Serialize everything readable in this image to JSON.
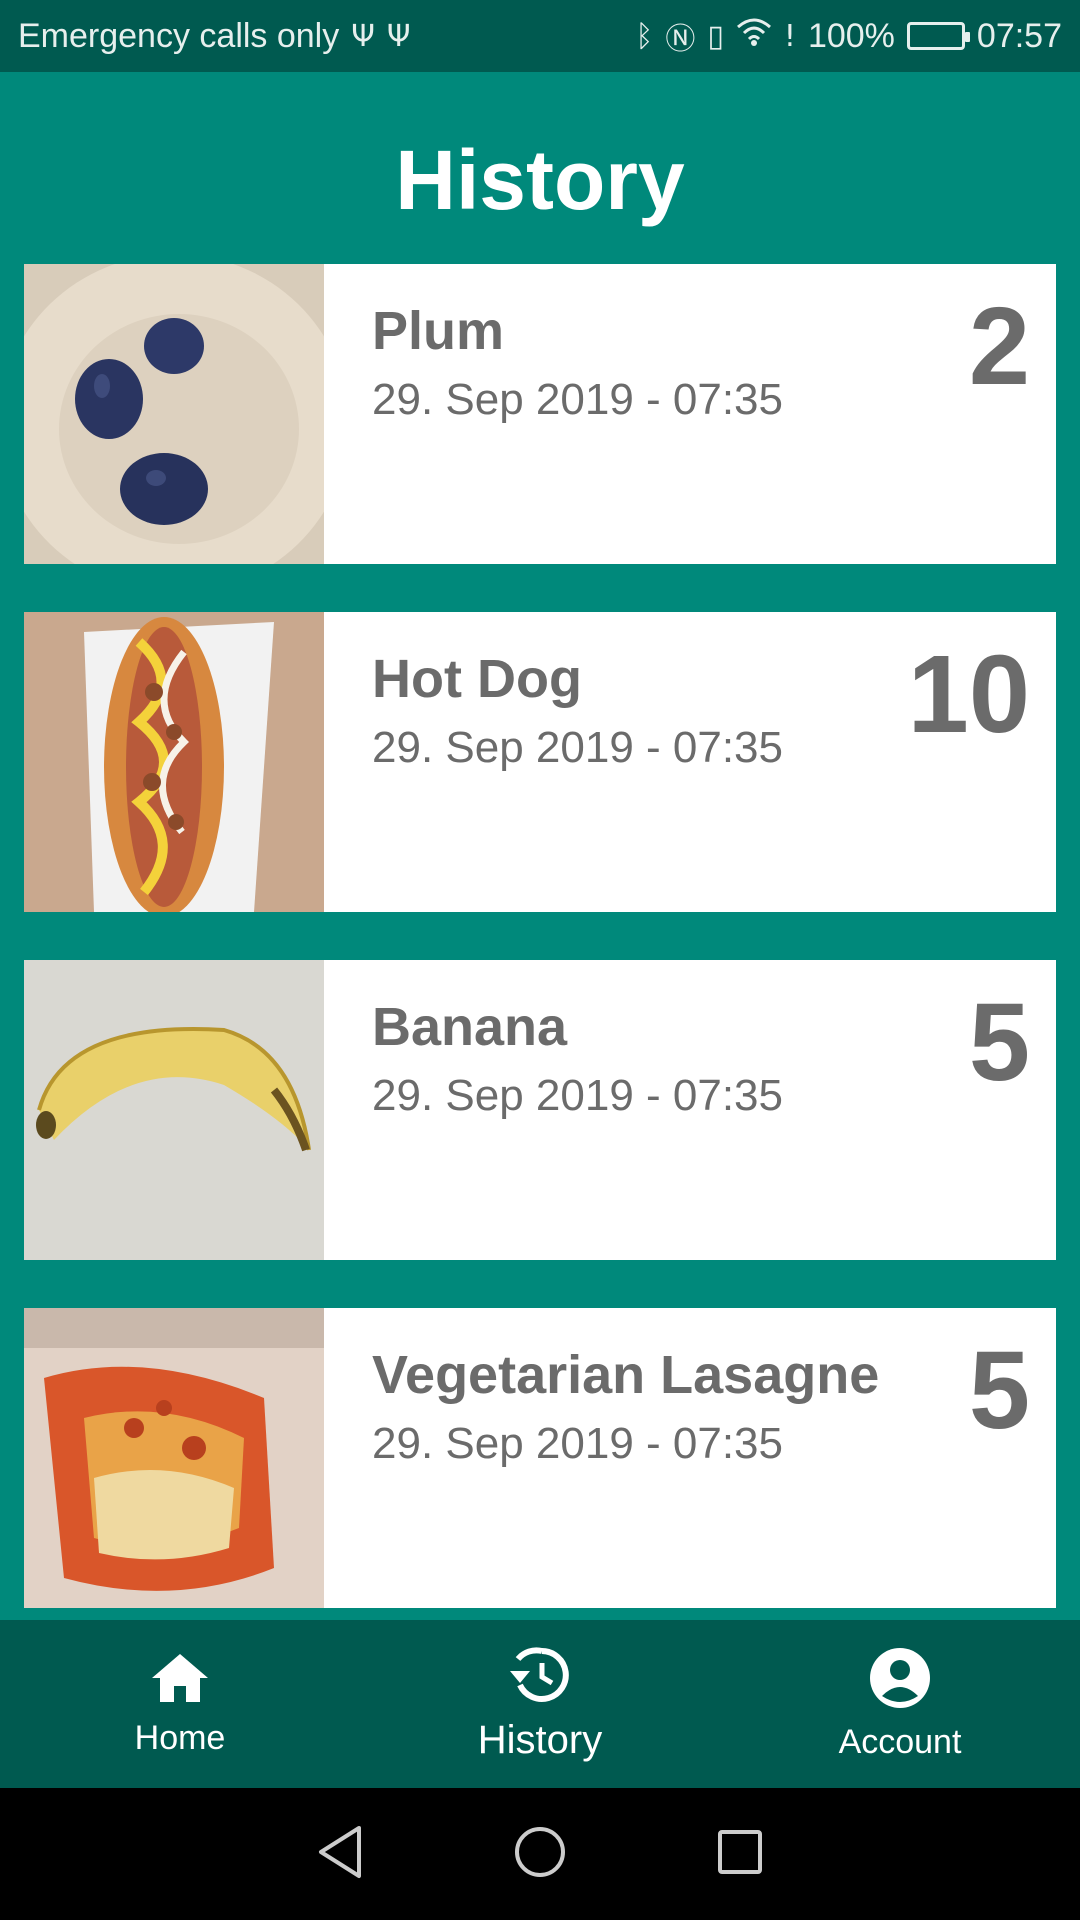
{
  "status_bar": {
    "carrier": "Emergency calls only",
    "battery": "100%",
    "time": "07:57",
    "icons": [
      "usb-icon",
      "usb-icon",
      "bluetooth-icon",
      "nfc-icon",
      "vibrate-icon",
      "wifi-icon",
      "alert-icon",
      "battery-icon"
    ],
    "battery_color": "#2ecc40"
  },
  "header": {
    "title": "History"
  },
  "history": {
    "items": [
      {
        "name": "Plum",
        "date": "29. Sep 2019 - 07:35",
        "score": "2",
        "image": "plums-on-plate"
      },
      {
        "name": "Hot Dog",
        "date": "29. Sep 2019 - 07:35",
        "score": "10",
        "image": "hot-dog"
      },
      {
        "name": "Banana",
        "date": "29. Sep 2019 - 07:35",
        "score": "5",
        "image": "banana"
      },
      {
        "name": "Vegetarian Lasagne",
        "date": "29. Sep 2019 - 07:35",
        "score": "5",
        "image": "lasagne"
      }
    ]
  },
  "bottom_nav": {
    "items": [
      {
        "label": "Home",
        "icon": "home-icon"
      },
      {
        "label": "History",
        "icon": "history-icon",
        "active": true
      },
      {
        "label": "Account",
        "icon": "account-icon"
      }
    ]
  },
  "colors": {
    "background": "#00897b",
    "bar": "#005a50",
    "card": "#ffffff",
    "text": "#6b6b6b"
  }
}
